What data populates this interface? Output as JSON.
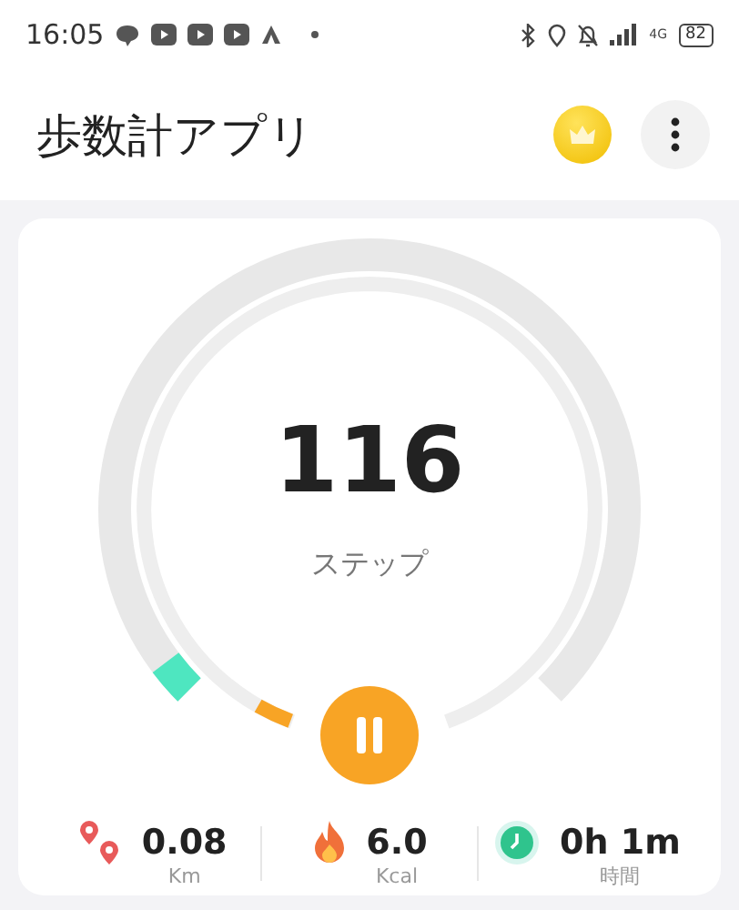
{
  "status_bar": {
    "time": "16:05",
    "network": "4G",
    "battery": "82"
  },
  "app_bar": {
    "title": "歩数計アプリ"
  },
  "ring": {
    "steps": "116",
    "unit": "ステップ",
    "paused": false
  },
  "stats": [
    {
      "kind": "distance",
      "value": "0.08",
      "unit": "Km"
    },
    {
      "kind": "calories",
      "value": "6.0",
      "unit": "Kcal"
    },
    {
      "kind": "time",
      "value": "0h 1m",
      "unit": "時間"
    }
  ]
}
